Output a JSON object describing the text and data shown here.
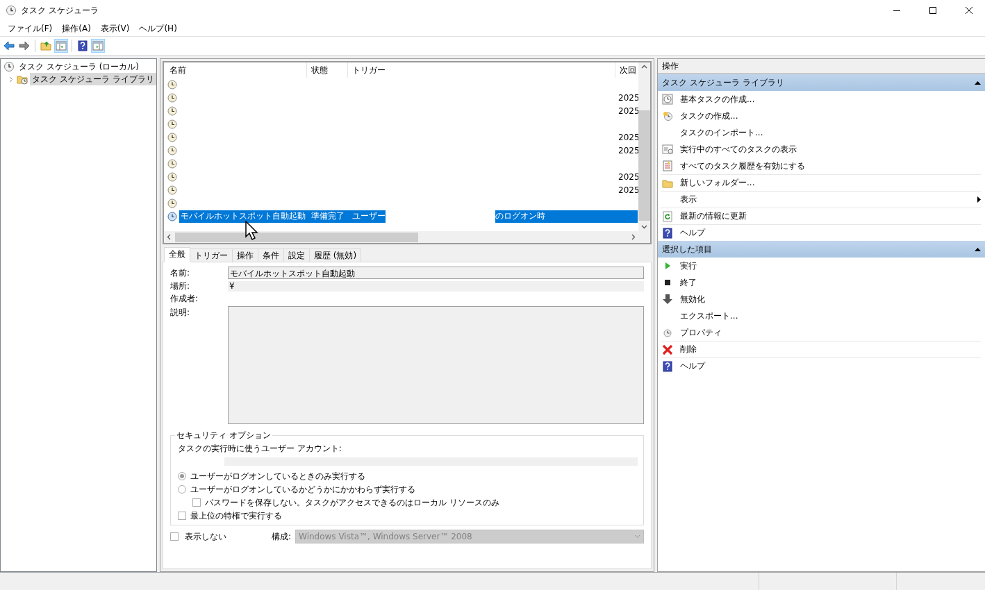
{
  "window": {
    "title": "タスク スケジューラ"
  },
  "menu": [
    "ファイル(F)",
    "操作(A)",
    "表示(V)",
    "ヘルプ(H)"
  ],
  "toolbar": [
    {
      "kind": "back",
      "pressed": false
    },
    {
      "kind": "forward",
      "pressed": false
    },
    {
      "kind": "up",
      "pressed": false
    },
    {
      "kind": "tree-toggle",
      "pressed": true
    },
    {
      "kind": "help",
      "pressed": false
    },
    {
      "kind": "pane-toggle",
      "pressed": true
    }
  ],
  "tree": [
    {
      "label": "タスク スケジューラ (ローカル)",
      "selected": false,
      "children": [
        {
          "label": "タスク スケジューラ ライブラリ",
          "selected": false,
          "expanded": false,
          "highlighted": true
        }
      ]
    }
  ],
  "task_list": {
    "columns": [
      "名前",
      "状態",
      "トリガー",
      "次回"
    ],
    "rows": [
      {
        "selected": false
      },
      {
        "selected": false,
        "next_run": "2025"
      },
      {
        "selected": false,
        "next_run": "2025"
      },
      {
        "selected": false
      },
      {
        "selected": false,
        "next_run": "2025"
      },
      {
        "selected": false,
        "next_run": "2025"
      },
      {
        "selected": false
      },
      {
        "selected": false,
        "next_run": "2025"
      },
      {
        "selected": false,
        "next_run": "2025"
      },
      {
        "selected": false
      },
      {
        "selected": true,
        "name": "モバイルホットスポット自動起動",
        "status": "準備完了",
        "trigger_start": "ユーザー",
        "trigger_end": "のログオン時"
      }
    ]
  },
  "details": {
    "tabs": [
      {
        "label": "全般",
        "selected": true
      },
      {
        "label": "トリガー",
        "selected": false
      },
      {
        "label": "操作",
        "selected": false
      },
      {
        "label": "条件",
        "selected": false
      },
      {
        "label": "設定",
        "selected": false
      },
      {
        "label": "履歴 (無効)",
        "selected": false
      }
    ],
    "name_label": "名前:",
    "name_value": "モバイルホットスポット自動起動",
    "location_label": "場所:",
    "location_value": "¥",
    "author_label": "作成者:",
    "description_label": "説明:",
    "security": {
      "title": "セキュリティ オプション",
      "account_label": "タスクの実行時に使うユーザー アカウント:",
      "options": [
        {
          "kind": "radio",
          "label": "ユーザーがログオンしているときのみ実行する",
          "selected": true
        },
        {
          "kind": "radio",
          "label": "ユーザーがログオンしているかどうかにかかわらず実行する",
          "selected": false
        },
        {
          "kind": "sub-checkbox",
          "label": "パスワードを保存しない。タスクがアクセスできるのはローカル リソースのみ",
          "checked": false
        },
        {
          "kind": "checkbox",
          "label": "最上位の特権で実行する",
          "checked": false
        }
      ]
    },
    "hidden_label": "表示しない",
    "hidden_checked": false,
    "config_label": "構成:",
    "config_value": "Windows Vista™, Windows Server™ 2008",
    "config_disabled": true
  },
  "actions": {
    "title": "操作",
    "sections": [
      {
        "title": "タスク スケジューラ ライブラリ",
        "expanded": true,
        "items": [
          {
            "kind": "basic-task",
            "label": "基本タスクの作成...",
            "divider_before": false
          },
          {
            "kind": "create-task",
            "label": "タスクの作成...",
            "divider_before": false
          },
          {
            "kind": "plain",
            "label": "タスクのインポート...",
            "divider_before": false
          },
          {
            "kind": "running",
            "label": "実行中のすべてのタスクの表示",
            "divider_before": false
          },
          {
            "kind": "history",
            "label": "すべてのタスク履歴を有効にする",
            "divider_before": false
          },
          {
            "kind": "folder",
            "label": "新しいフォルダー...",
            "divider_before": true
          },
          {
            "kind": "submenu",
            "label": "表示",
            "divider_before": true
          },
          {
            "kind": "refresh",
            "label": "最新の情報に更新",
            "divider_before": true
          },
          {
            "kind": "help",
            "label": "ヘルプ",
            "divider_before": true
          }
        ]
      },
      {
        "title": "選択した項目",
        "expanded": true,
        "items": [
          {
            "kind": "run",
            "label": "実行",
            "divider_before": false
          },
          {
            "kind": "stop",
            "label": "終了",
            "divider_before": false
          },
          {
            "kind": "disable",
            "label": "無効化",
            "divider_before": false
          },
          {
            "kind": "plain",
            "label": "エクスポート...",
            "divider_before": false
          },
          {
            "kind": "properties",
            "label": "プロパティ",
            "divider_before": false
          },
          {
            "kind": "delete",
            "label": "削除",
            "divider_before": true
          },
          {
            "kind": "help",
            "label": "ヘルプ",
            "divider_before": true
          }
        ]
      }
    ]
  }
}
